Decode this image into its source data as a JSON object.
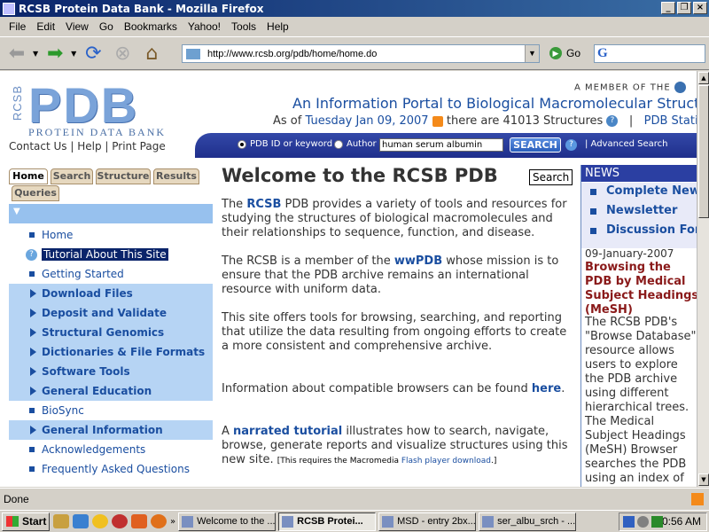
{
  "window": {
    "title": "RCSB Protein Data Bank - Mozilla Firefox"
  },
  "menubar": [
    "File",
    "Edit",
    "View",
    "Go",
    "Bookmarks",
    "Yahoo!",
    "Tools",
    "Help"
  ],
  "toolbar": {
    "url": "http://www.rcsb.org/pdb/home/home.do",
    "go_label": "Go",
    "search_engine_glyph": "G"
  },
  "header": {
    "logo_side": "RCSB",
    "logo_main": "PDB",
    "logo_sub": "PROTEIN DATA BANK",
    "member": "A MEMBER OF THE",
    "portal": "An Information Portal to Biological Macromolecular Structures",
    "asof_prefix": "As of",
    "date": "Tuesday Jan 09, 2007",
    "count_text": "there are 41013 Structures",
    "separator": "|",
    "stats": "PDB Statistics"
  },
  "toplinks": "Contact Us | Help | Print Page",
  "search": {
    "opt1": "PDB ID or keyword",
    "opt2": "Author",
    "value": "human serum albumin",
    "button": "SEARCH",
    "advanced": "| Advanced Search"
  },
  "tabs": [
    "Home",
    "Search",
    "Structure",
    "Results",
    "Queries"
  ],
  "leftnav": [
    {
      "label": "Home",
      "style": "plain"
    },
    {
      "label": "Tutorial About This Site",
      "style": "selected"
    },
    {
      "label": "Getting Started",
      "style": "plain"
    },
    {
      "label": "Download Files",
      "style": "bold"
    },
    {
      "label": "Deposit and Validate",
      "style": "bold"
    },
    {
      "label": "Structural Genomics",
      "style": "bold"
    },
    {
      "label": "Dictionaries & File Formats",
      "style": "bold"
    },
    {
      "label": "Software Tools",
      "style": "bold"
    },
    {
      "label": "General Education",
      "style": "bold"
    },
    {
      "label": "BioSync",
      "style": "plain"
    },
    {
      "label": "General Information",
      "style": "bold"
    },
    {
      "label": "Acknowledgements",
      "style": "plain"
    },
    {
      "label": "Frequently Asked Questions",
      "style": "plain"
    }
  ],
  "main": {
    "title": "Welcome to the RCSB PDB",
    "search_tag": "Search",
    "p1_pre": "The ",
    "p1_link": "RCSB",
    "p1_post": " PDB provides a variety of tools and resources for studying the structures of biological macromolecules and their relationships to sequence, function, and disease.",
    "p2_pre": "The RCSB is a member of the ",
    "p2_link": "wwPDB",
    "p2_post": " whose mission is to ensure that the PDB archive remains an international resource with uniform data.",
    "p3": "This site offers tools for browsing, searching, and reporting that utilize the data resulting from ongoing efforts to create a more consistent and comprehensive archive.",
    "p4_pre": "Information about compatible browsers can be found ",
    "p4_link": "here",
    "p4_post": ".",
    "p5_pre": "A ",
    "p5_link": "narrated tutorial",
    "p5_post": " illustrates how to search, navigate, browse, generate reports and visualize structures using this new site. ",
    "p5_small_pre": "[This requires the Macromedia ",
    "p5_small_link": "Flash player download",
    "p5_small_post": ".]"
  },
  "news": {
    "heading": "NEWS",
    "links": [
      "Complete News",
      "Newsletter",
      "Discussion Forum"
    ],
    "date": "09-January-2007",
    "title": "Browsing the PDB by Medical Subject Headings (MeSH)",
    "body": "The RCSB PDB's \"Browse Database\" resource allows users to explore the PDB archive using different hierarchical trees. The Medical Subject Headings (MeSH) Browser searches the PDB using an index of biomedical-related publications from the National Library of Medicine"
  },
  "status": {
    "text": "Done"
  },
  "taskbar": {
    "start": "Start",
    "tasks": [
      {
        "label": "Welcome to the ...",
        "active": false
      },
      {
        "label": "RCSB Protei...",
        "active": true
      },
      {
        "label": "MSD - entry 2bx...",
        "active": false
      },
      {
        "label": "ser_albu_srch - ...",
        "active": false
      }
    ],
    "clock": "10:56 AM"
  }
}
